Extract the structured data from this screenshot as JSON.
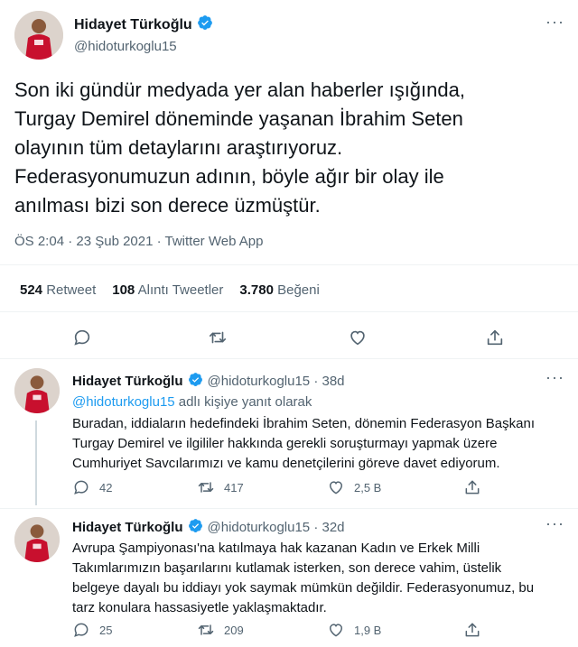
{
  "main_tweet": {
    "name": "Hidayet Türkoğlu",
    "handle": "@hidoturkoglu15",
    "text_lines": [
      "Son iki gündür medyada yer alan haberler ışığında,",
      "Turgay Demirel döneminde yaşanan İbrahim Seten",
      "olayının tüm detaylarını araştırıyoruz.",
      "Federasyonumuzun adının, böyle ağır bir olay ile",
      "anılması bizi son derece üzmüştür."
    ],
    "meta": "ÖS 2:04 · 23 Şub 2021 · Twitter Web App",
    "stats": {
      "retweet_count": "524",
      "retweet_label": "Retweet",
      "quote_count": "108",
      "quote_label": "Alıntı Tweetler",
      "like_count": "3.780",
      "like_label": "Beğeni"
    }
  },
  "replies": [
    {
      "name": "Hidayet Türkoğlu",
      "handle_time": "@hidoturkoglu15 · 38d",
      "reply_to_handle": "@hidoturkoglu15",
      "reply_to_suffix": " adlı kişiye yanıt olarak",
      "text_lines": [
        "Buradan, iddiaların hedefindeki İbrahim Seten, dönemin Federasyon Başkanı",
        "Turgay Demirel ve ilgililer hakkında gerekli soruşturmayı yapmak üzere",
        "Cumhuriyet Savcılarımızı ve kamu denetçilerini göreve davet ediyorum."
      ],
      "replies_count": "42",
      "retweets_count": "417",
      "likes_count": "2,5 B"
    },
    {
      "name": "Hidayet Türkoğlu",
      "handle_time": "@hidoturkoglu15 · 32d",
      "text_lines": [
        "Avrupa Şampiyonası'na katılmaya hak kazanan Kadın ve Erkek Milli",
        "Takımlarımızın başarılarını kutlamak isterken, son derece vahim, üstelik",
        "belgeye dayalı bu iddiayı yok saymak mümkün değildir. Federasyonumuz, bu",
        "tarz konulara hassasiyetle yaklaşmaktadır."
      ],
      "replies_count": "25",
      "retweets_count": "209",
      "likes_count": "1,9 B"
    }
  ],
  "colors": {
    "accent": "#1d9bf0",
    "muted": "#536471",
    "divider": "#eff3f4",
    "jersey_red": "#c8102e"
  },
  "icons": [
    "verified-badge-icon",
    "more-icon",
    "reply-icon",
    "retweet-icon",
    "like-icon",
    "share-icon"
  ]
}
